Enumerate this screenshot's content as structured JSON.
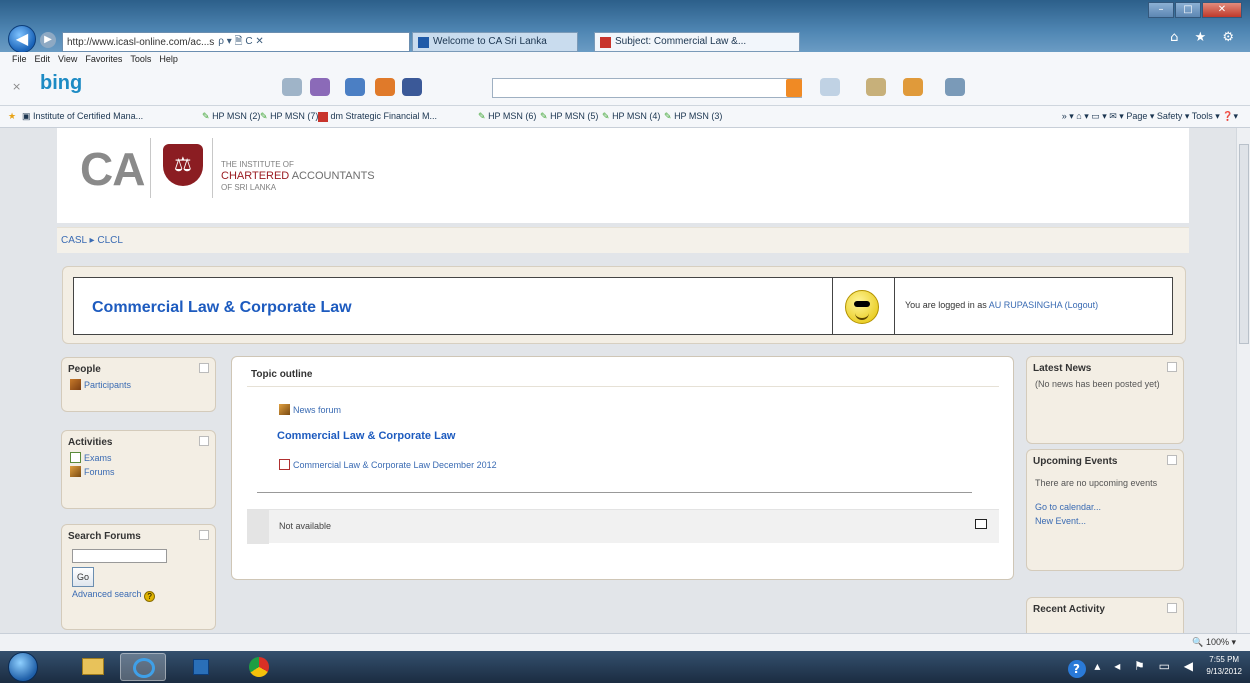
{
  "browser": {
    "address": "http://www.icasl-online.com/ac...s",
    "address_controls": "ρ ▾ 🗎 C ✕",
    "tabs": [
      {
        "label": "Welcome to CA Sri Lanka"
      },
      {
        "label": "Subject: Commercial Law &..."
      }
    ],
    "window_controls": [
      "–",
      "□",
      "✕"
    ],
    "right_icons": "⌂ ★ ⚙",
    "menu": [
      "File",
      "Edit",
      "View",
      "Favorites",
      "Tools",
      "Help"
    ],
    "bing": {
      "logo": "bing",
      "close": "×"
    },
    "favorites": [
      "Institute of Certified Mana...",
      "HP MSN (2)",
      "HP MSN (7)",
      "dm Strategic Financial M...",
      "HP MSN (6)",
      "HP MSN (5)",
      "HP MSN (4)",
      "HP MSN (3)"
    ],
    "command_bar": "» ▾ ⌂ ▾ ▭ ▾ ✉ ▾ Page ▾ Safety ▾ Tools ▾ ❓▾",
    "zoom": "🔍 100% ▾"
  },
  "site": {
    "logo_ca": "CA",
    "logo_line1": "THE INSTITUTE OF",
    "logo_line2_bold": "CHARTERED",
    "logo_line2_rest": " ACCOUNTANTS",
    "logo_line3": "OF SRI LANKA"
  },
  "breadcrumb": {
    "root": "CASL",
    "sep": "▸",
    "current": "CLCL"
  },
  "course": {
    "title": "Commercial Law & Corporate Law",
    "login_prefix": "You are logged in as ",
    "user": "AU RUPASINGHA",
    "logout": "(Logout)"
  },
  "blocks": {
    "people": {
      "title": "People",
      "items": [
        "Participants"
      ]
    },
    "activities": {
      "title": "Activities",
      "items": [
        "Exams",
        "Forums"
      ]
    },
    "search": {
      "title": "Search Forums",
      "go": "Go",
      "advanced": "Advanced search"
    },
    "news": {
      "title": "Latest News",
      "text": "(No news has been posted yet)"
    },
    "events": {
      "title": "Upcoming Events",
      "text": "There are no upcoming events",
      "link1": "Go to calendar...",
      "link2": "New Event..."
    },
    "recent": {
      "title": "Recent Activity"
    }
  },
  "topic": {
    "heading": "Topic outline",
    "news_forum": "News forum",
    "section_title": "Commercial Law & Corporate Law",
    "resource": "Commercial Law & Corporate Law December 2012",
    "section1_text": "Not available"
  },
  "taskbar": {
    "tray": "▴ ◂ ⚑ ▭ ◀",
    "tray_help": "?",
    "time": "7:55 PM",
    "date": "9/13/2012"
  }
}
